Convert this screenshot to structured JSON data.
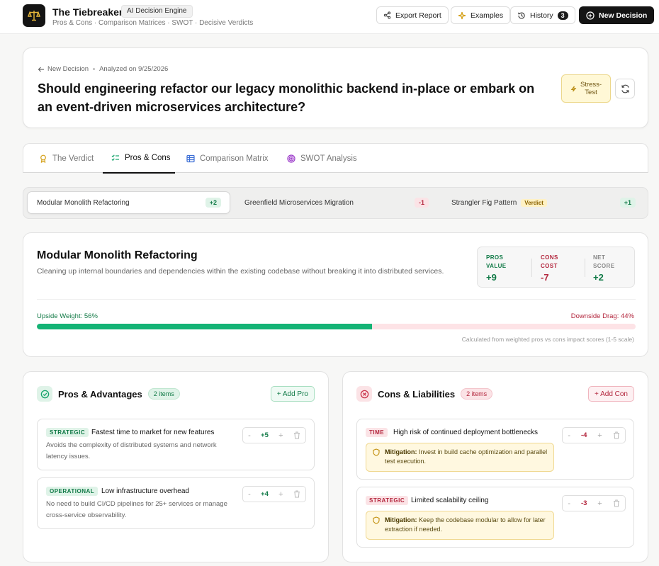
{
  "header": {
    "app_title": "The Tiebreaker",
    "app_badge": "AI Decision Engine",
    "subtitle": "Pros & Cons · Comparison Matrices · SWOT · Decisive Verdicts",
    "export_label": "Export Report",
    "examples_label": "Examples",
    "history_label": "History",
    "history_count": "3",
    "new_decision_label": "New Decision"
  },
  "question_card": {
    "back_label": "New Decision",
    "analyzed": "Analyzed on 9/25/2026",
    "question": "Should engineering refactor our legacy monolithic backend in-place or embark on an event-driven microservices architecture?",
    "stress_label": "Stress-Test"
  },
  "tabs": [
    {
      "label": "The Verdict"
    },
    {
      "label": "Pros & Cons"
    },
    {
      "label": "Comparison Matrix"
    },
    {
      "label": "SWOT Analysis"
    }
  ],
  "active_tab": "Pros & Cons",
  "options": [
    {
      "label": "Modular Monolith Refactoring",
      "score": "+2"
    },
    {
      "label": "Greenfield Microservices Migration",
      "score": "-1"
    },
    {
      "label": "Strangler Fig Pattern",
      "score": "+1",
      "tag": "Verdict"
    }
  ],
  "summary": {
    "title": "Modular Monolith Refactoring",
    "description": "Cleaning up internal boundaries and dependencies within the existing codebase without breaking it into distributed services.",
    "pros_label_1": "PROS",
    "pros_label_2": "VALUE",
    "pros_value": "+9",
    "cons_label_1": "CONS",
    "cons_label_2": "COST",
    "cons_value": "-7",
    "net_label_1": "NET",
    "net_label_2": "SCORE",
    "net_value": "+2",
    "upside_label": "Upside Weight: 56%",
    "downside_label": "Downside Drag: 44%",
    "upside_fraction": 0.56,
    "calc_note": "Calculated from weighted pros vs cons impact scores (1-5 scale)"
  },
  "pros": {
    "title": "Pros & Advantages",
    "count": "2 items",
    "add_label": "+ Add Pro",
    "items": [
      {
        "category": "STRATEGIC",
        "title": "Fastest time to market for new features",
        "description": "Avoids the complexity of distributed systems and network latency issues.",
        "score": "+5",
        "minus": "-",
        "plus": "+"
      },
      {
        "category": "OPERATIONAL",
        "title": "Low infrastructure overhead",
        "description": "No need to build CI/CD pipelines for 25+ services or manage cross-service observability.",
        "score": "+4",
        "minus": "-",
        "plus": "+"
      }
    ]
  },
  "cons": {
    "title": "Cons & Liabilities",
    "count": "2 items",
    "add_label": "+ Add Con",
    "items": [
      {
        "category": "TIME",
        "title": "High risk of continued deployment bottlenecks",
        "mitigation_label": "Mitigation:",
        "mitigation": "Invest in build cache optimization and parallel test execution.",
        "score": "-4",
        "minus": "-",
        "plus": "+"
      },
      {
        "category": "STRATEGIC",
        "title": "Limited scalability ceiling",
        "mitigation_label": "Mitigation:",
        "mitigation": "Keep the codebase modular to allow for later extraction if needed.",
        "score": "-3",
        "minus": "-",
        "plus": "+"
      }
    ]
  },
  "colors": {
    "positive": "#117a47",
    "negative": "#b3263d",
    "accent_bar": "#14b375",
    "dark": "#141414"
  }
}
